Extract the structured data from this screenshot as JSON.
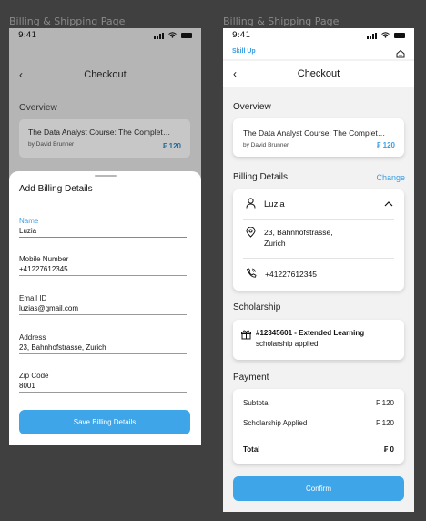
{
  "frames": {
    "left_label": "Billing & Shipping Page",
    "right_label": "Billing & Shipping Page"
  },
  "status_bar": {
    "time": "9:41"
  },
  "brand": {
    "name": "Skill Up"
  },
  "header": {
    "title": "Checkout",
    "back_glyph": "‹"
  },
  "overview": {
    "heading": "Overview",
    "course_title": "The Data Analyst Course: The Complete Data Analyst Bootcamp",
    "author": "by David Brunner",
    "price": "₣ 120"
  },
  "sheet": {
    "title": "Add Billing Details",
    "fields": [
      {
        "label": "Name",
        "value": "Luzia"
      },
      {
        "label": "Mobile Number",
        "value": "+41227612345"
      },
      {
        "label": "Email ID",
        "value": "luzias@gmail.com"
      },
      {
        "label": "Address",
        "value": "23, Bahnhofstrasse, Zurich"
      },
      {
        "label": "Zip Code",
        "value": "8001"
      }
    ],
    "save_label": "Save Billing Details"
  },
  "billing": {
    "heading": "Billing Details",
    "change_label": "Change",
    "name": "Luzia",
    "address_line1": "23, Bahnhofstrasse,",
    "address_line2": "Zurich",
    "phone": "+41227612345"
  },
  "scholarship": {
    "heading": "Scholarship",
    "code_text": "#12345601 - Extended Learning",
    "status_text": "scholarship applied!"
  },
  "payment": {
    "heading": "Payment",
    "rows": [
      {
        "label": "Subtotal",
        "value": "₣ 120"
      },
      {
        "label": "Scholarship Applied",
        "value": "₣ 120"
      }
    ],
    "total_label": "Total",
    "total_value": "₣ 0"
  },
  "confirm_label": "Confirm",
  "colors": {
    "accent": "#3ea5e8",
    "link": "#3a9ee4"
  },
  "icons": [
    "signal-icon",
    "wifi-icon",
    "battery-icon",
    "home-icon",
    "user-icon",
    "location-pin-icon",
    "phone-icon",
    "gift-icon",
    "chevron-up-icon",
    "back-arrow-icon"
  ]
}
